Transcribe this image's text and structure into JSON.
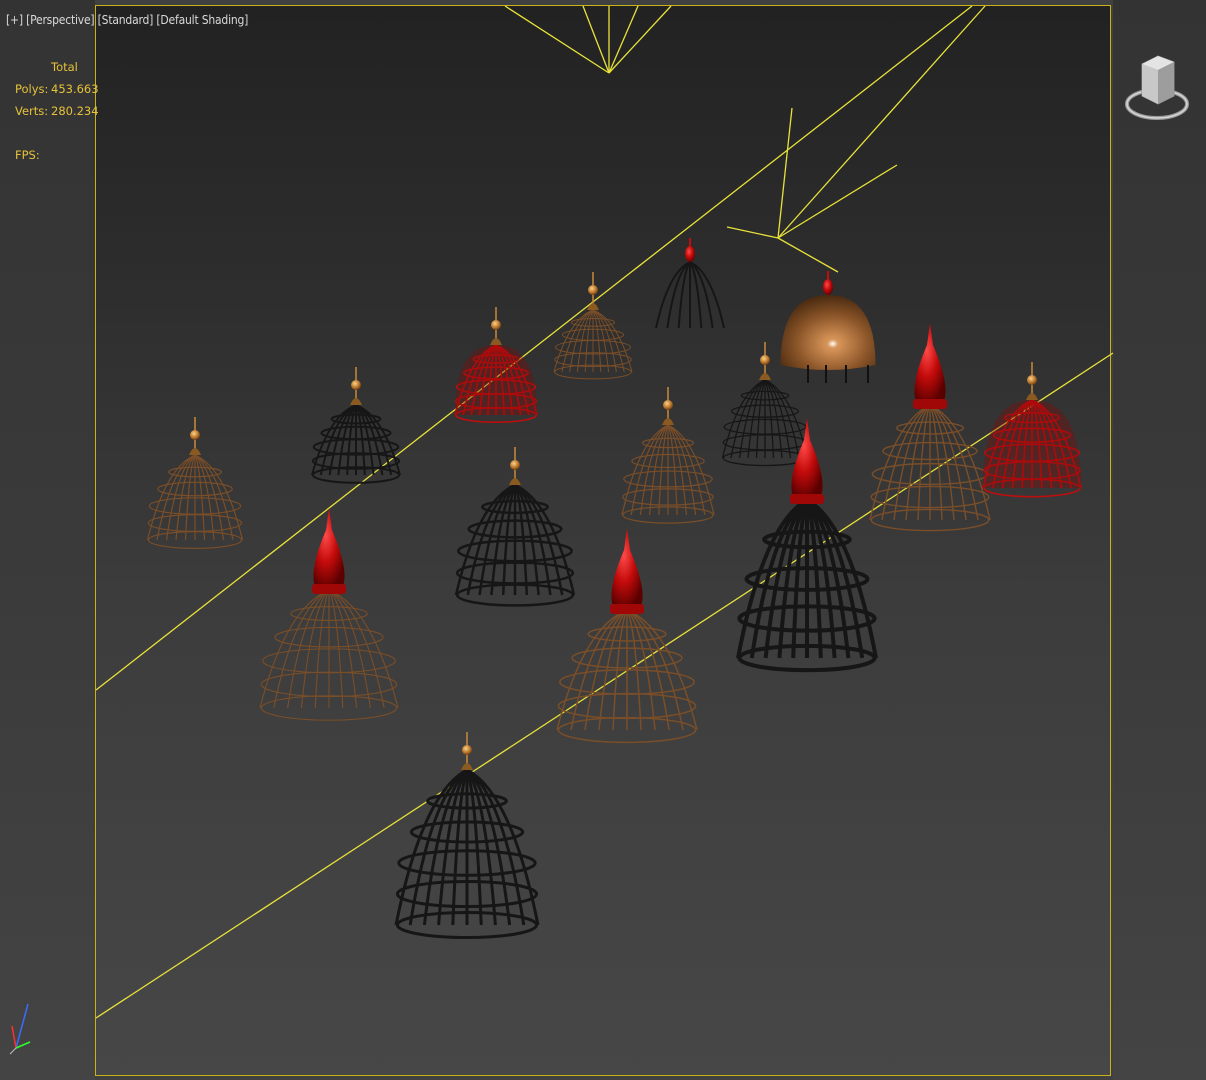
{
  "viewport": {
    "labels": {
      "plus": "[+]",
      "view": "[Perspective]",
      "mode": "[Standard]",
      "shading": "[Default Shading]"
    },
    "stats": {
      "header": "Total",
      "polys_label": "Polys:",
      "polys_value": "453.663",
      "verts_label": "Verts:",
      "verts_value": "280.234",
      "fps_label": "FPS:"
    },
    "colors": {
      "frame": "#c9b21a",
      "stats_text": "#e6c23a",
      "camera_lines": "#e8e23a"
    },
    "icons": [
      "viewcube-icon",
      "axis-tripod-icon"
    ]
  }
}
